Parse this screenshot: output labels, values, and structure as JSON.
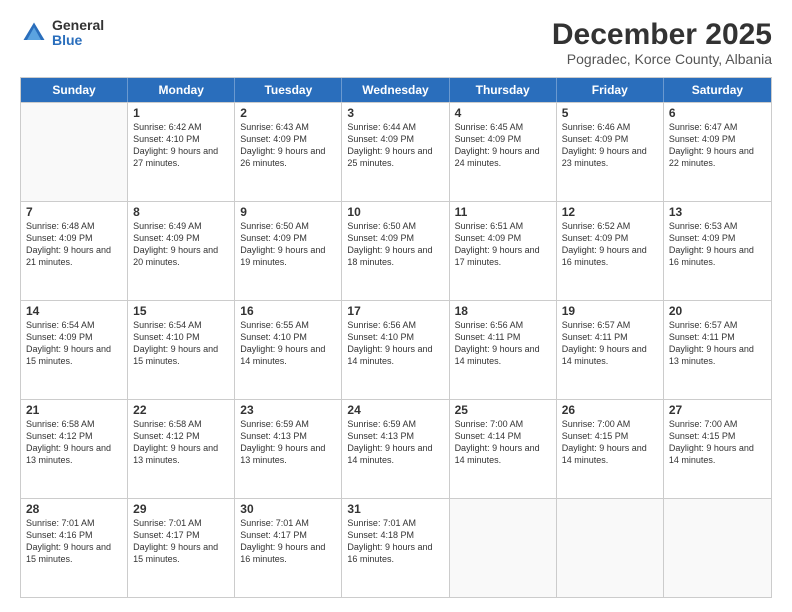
{
  "logo": {
    "general": "General",
    "blue": "Blue"
  },
  "title": "December 2025",
  "location": "Pogradec, Korce County, Albania",
  "days_header": [
    "Sunday",
    "Monday",
    "Tuesday",
    "Wednesday",
    "Thursday",
    "Friday",
    "Saturday"
  ],
  "weeks": [
    [
      {
        "day": null,
        "info": null
      },
      {
        "day": "1",
        "sunrise": "6:42 AM",
        "sunset": "4:10 PM",
        "daylight": "9 hours and 27 minutes."
      },
      {
        "day": "2",
        "sunrise": "6:43 AM",
        "sunset": "4:09 PM",
        "daylight": "9 hours and 26 minutes."
      },
      {
        "day": "3",
        "sunrise": "6:44 AM",
        "sunset": "4:09 PM",
        "daylight": "9 hours and 25 minutes."
      },
      {
        "day": "4",
        "sunrise": "6:45 AM",
        "sunset": "4:09 PM",
        "daylight": "9 hours and 24 minutes."
      },
      {
        "day": "5",
        "sunrise": "6:46 AM",
        "sunset": "4:09 PM",
        "daylight": "9 hours and 23 minutes."
      },
      {
        "day": "6",
        "sunrise": "6:47 AM",
        "sunset": "4:09 PM",
        "daylight": "9 hours and 22 minutes."
      }
    ],
    [
      {
        "day": "7",
        "sunrise": "6:48 AM",
        "sunset": "4:09 PM",
        "daylight": "9 hours and 21 minutes."
      },
      {
        "day": "8",
        "sunrise": "6:49 AM",
        "sunset": "4:09 PM",
        "daylight": "9 hours and 20 minutes."
      },
      {
        "day": "9",
        "sunrise": "6:50 AM",
        "sunset": "4:09 PM",
        "daylight": "9 hours and 19 minutes."
      },
      {
        "day": "10",
        "sunrise": "6:50 AM",
        "sunset": "4:09 PM",
        "daylight": "9 hours and 18 minutes."
      },
      {
        "day": "11",
        "sunrise": "6:51 AM",
        "sunset": "4:09 PM",
        "daylight": "9 hours and 17 minutes."
      },
      {
        "day": "12",
        "sunrise": "6:52 AM",
        "sunset": "4:09 PM",
        "daylight": "9 hours and 16 minutes."
      },
      {
        "day": "13",
        "sunrise": "6:53 AM",
        "sunset": "4:09 PM",
        "daylight": "9 hours and 16 minutes."
      }
    ],
    [
      {
        "day": "14",
        "sunrise": "6:54 AM",
        "sunset": "4:09 PM",
        "daylight": "9 hours and 15 minutes."
      },
      {
        "day": "15",
        "sunrise": "6:54 AM",
        "sunset": "4:10 PM",
        "daylight": "9 hours and 15 minutes."
      },
      {
        "day": "16",
        "sunrise": "6:55 AM",
        "sunset": "4:10 PM",
        "daylight": "9 hours and 14 minutes."
      },
      {
        "day": "17",
        "sunrise": "6:56 AM",
        "sunset": "4:10 PM",
        "daylight": "9 hours and 14 minutes."
      },
      {
        "day": "18",
        "sunrise": "6:56 AM",
        "sunset": "4:11 PM",
        "daylight": "9 hours and 14 minutes."
      },
      {
        "day": "19",
        "sunrise": "6:57 AM",
        "sunset": "4:11 PM",
        "daylight": "9 hours and 14 minutes."
      },
      {
        "day": "20",
        "sunrise": "6:57 AM",
        "sunset": "4:11 PM",
        "daylight": "9 hours and 13 minutes."
      }
    ],
    [
      {
        "day": "21",
        "sunrise": "6:58 AM",
        "sunset": "4:12 PM",
        "daylight": "9 hours and 13 minutes."
      },
      {
        "day": "22",
        "sunrise": "6:58 AM",
        "sunset": "4:12 PM",
        "daylight": "9 hours and 13 minutes."
      },
      {
        "day": "23",
        "sunrise": "6:59 AM",
        "sunset": "4:13 PM",
        "daylight": "9 hours and 13 minutes."
      },
      {
        "day": "24",
        "sunrise": "6:59 AM",
        "sunset": "4:13 PM",
        "daylight": "9 hours and 14 minutes."
      },
      {
        "day": "25",
        "sunrise": "7:00 AM",
        "sunset": "4:14 PM",
        "daylight": "9 hours and 14 minutes."
      },
      {
        "day": "26",
        "sunrise": "7:00 AM",
        "sunset": "4:15 PM",
        "daylight": "9 hours and 14 minutes."
      },
      {
        "day": "27",
        "sunrise": "7:00 AM",
        "sunset": "4:15 PM",
        "daylight": "9 hours and 14 minutes."
      }
    ],
    [
      {
        "day": "28",
        "sunrise": "7:01 AM",
        "sunset": "4:16 PM",
        "daylight": "9 hours and 15 minutes."
      },
      {
        "day": "29",
        "sunrise": "7:01 AM",
        "sunset": "4:17 PM",
        "daylight": "9 hours and 15 minutes."
      },
      {
        "day": "30",
        "sunrise": "7:01 AM",
        "sunset": "4:17 PM",
        "daylight": "9 hours and 16 minutes."
      },
      {
        "day": "31",
        "sunrise": "7:01 AM",
        "sunset": "4:18 PM",
        "daylight": "9 hours and 16 minutes."
      },
      {
        "day": null,
        "info": null
      },
      {
        "day": null,
        "info": null
      },
      {
        "day": null,
        "info": null
      }
    ]
  ]
}
